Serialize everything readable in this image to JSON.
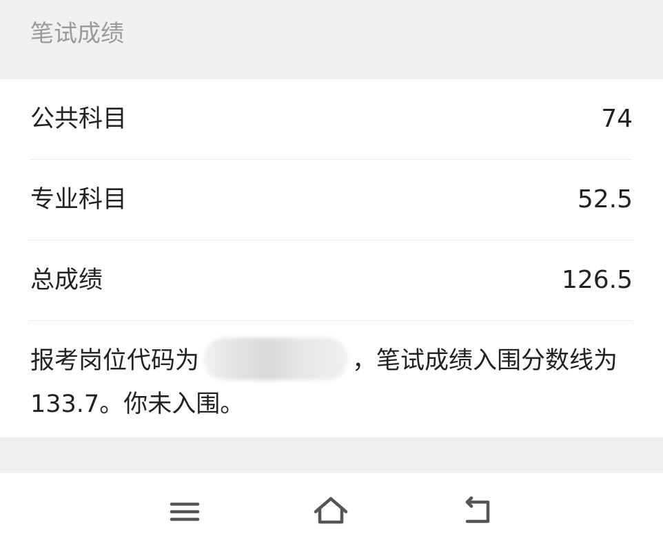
{
  "section": {
    "title": "笔试成绩"
  },
  "scores": [
    {
      "label": "公共科目",
      "value": "74"
    },
    {
      "label": "专业科目",
      "value": "52.5"
    },
    {
      "label": "总成绩",
      "value": "126.5"
    }
  ],
  "result": {
    "prefix": "报考岗位代码为",
    "suffix": "，笔试成绩入围分数线为133.7。你未入围。"
  },
  "nav": {
    "icons": [
      "menu-icon",
      "home-icon",
      "back-icon"
    ]
  }
}
